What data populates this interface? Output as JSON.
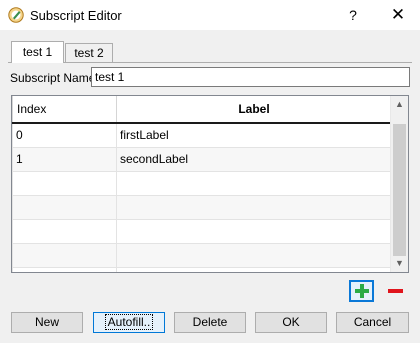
{
  "window": {
    "title": "Subscript Editor",
    "help_label": "?",
    "close_label": "✕"
  },
  "tabs": [
    {
      "label": "test 1"
    },
    {
      "label": "test 2"
    }
  ],
  "subscript": {
    "label": "Subscript Name",
    "value": "test 1"
  },
  "table": {
    "columns": [
      "Index",
      "Label"
    ],
    "rows": [
      {
        "index": "0",
        "label": "firstLabel"
      },
      {
        "index": "1",
        "label": "secondLabel"
      },
      {
        "index": "",
        "label": ""
      },
      {
        "index": "",
        "label": ""
      },
      {
        "index": "",
        "label": ""
      },
      {
        "index": "",
        "label": ""
      },
      {
        "index": "",
        "label": ""
      }
    ]
  },
  "buttons": {
    "new": "New",
    "autofill": "Autofill..",
    "delete": "Delete",
    "ok": "OK",
    "cancel": "Cancel"
  },
  "icons": {
    "app": "editor-app-icon",
    "add": "add-row-icon",
    "remove": "remove-row-icon",
    "scroll_up": "▲",
    "scroll_down": "▼"
  },
  "colors": {
    "add_icon": "#2bab46",
    "remove_icon": "#e0141c",
    "focus": "#0078d7"
  }
}
